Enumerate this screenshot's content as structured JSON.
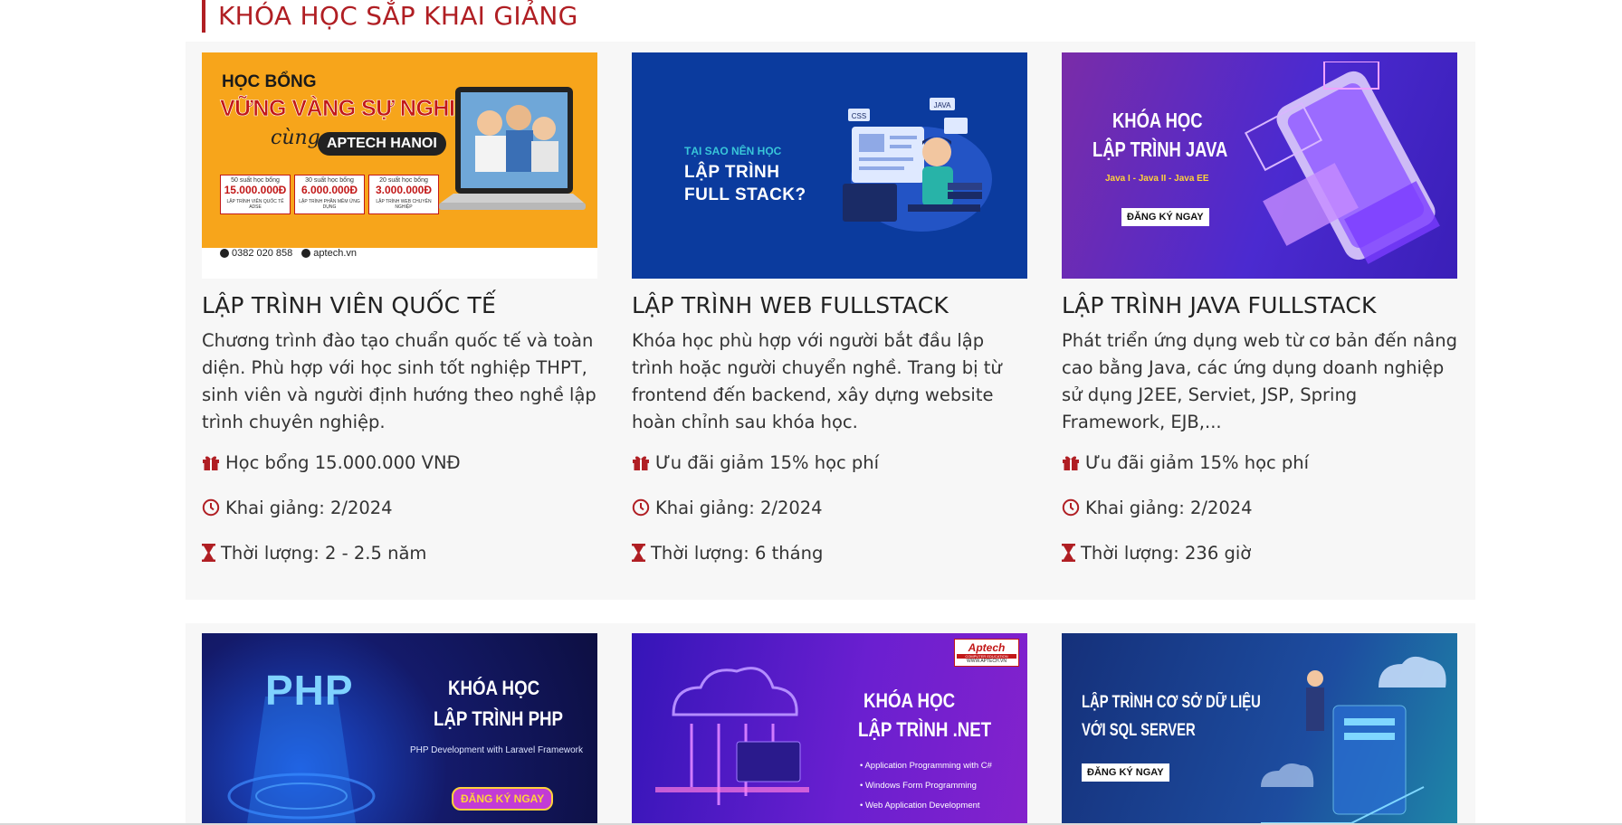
{
  "section": {
    "title": "KHÓA HỌC SẮP KHAI GIẢNG"
  },
  "colors": {
    "accent": "#b01e23",
    "panel": "#f7f7f7"
  },
  "courses": [
    {
      "title": "LẬP TRÌNH VIÊN QUỐC TẾ",
      "desc": "Chương trình đào tạo chuẩn quốc tế và toàn diện. Phù hợp với học sinh tốt nghiệp THPT, sinh viên và người định hướng theo nghề lập trình chuyên nghiệp.",
      "offer": "Học bổng 15.000.000 VNĐ",
      "start": "Khai giảng: 2/2024",
      "duration": "Thời lượng: 2 - 2.5 năm",
      "banner": {
        "l1": "HỌC BỔNG",
        "l2": "VỮNG VÀNG SỰ NGHIỆP",
        "l3": "cùng",
        "brand": "APTECH HANOI",
        "boxes": [
          {
            "cap": "50 suất học bổng",
            "amt": "15.000.000Đ",
            "sub": "LẬP TRÌNH VIÊN QUỐC TẾ ADSE"
          },
          {
            "cap": "30 suất học bổng",
            "amt": "6.000.000Đ",
            "sub": "LẬP TRÌNH PHẦN MỀM ỨNG DỤNG"
          },
          {
            "cap": "20 suất học bổng",
            "amt": "3.000.000Đ",
            "sub": "LẬP TRÌNH WEB CHUYÊN NGHIỆP"
          }
        ],
        "phone": "0382 020 858",
        "site": "aptech.vn"
      }
    },
    {
      "title": "LẬP TRÌNH WEB FULLSTACK",
      "desc": "Khóa học phù hợp với người bắt đầu lập trình hoặc người chuyển nghề. Trang bị từ frontend đến backend, xây dựng website hoàn chỉnh sau khóa học.",
      "offer": "Ưu đãi giảm 15% học phí",
      "start": "Khai giảng: 2/2024",
      "duration": "Thời lượng: 6 tháng",
      "banner": {
        "l1": "TẠI SAO NÊN HỌC",
        "l2": "LẬP TRÌNH",
        "l3": "FULL STACK?",
        "t1": "CSS",
        "t2": "JAVA"
      }
    },
    {
      "title": "LẬP TRÌNH JAVA FULLSTACK",
      "desc": "Phát triển ứng dụng web từ cơ bản đến nâng cao bằng Java, các ứng dụng doanh nghiệp sử dụng J2EE, Serviet, JSP, Spring Framework, EJB,...",
      "offer": "Ưu đãi giảm 15% học phí",
      "start": "Khai giảng: 2/2024",
      "duration": "Thời lượng: 236 giờ",
      "banner": {
        "l1": "KHÓA HỌC",
        "l2": "LẬP TRÌNH JAVA",
        "l3": "Java I - Java II - Java EE",
        "btn": "ĐĂNG KÝ NGAY"
      }
    }
  ],
  "row2": [
    {
      "logo": "PHP",
      "l1": "KHÓA HỌC",
      "l2": "LẬP TRÌNH PHP",
      "l3": "PHP Development with Laravel Framework",
      "btn": "ĐĂNG KÝ NGAY"
    },
    {
      "badge": "Aptech",
      "badge_sub": "COMPUTER EDUCATION",
      "badge_site": "WWW.APTECH.VN",
      "l1": "KHÓA HỌC",
      "l2": "LẬP TRÌNH .NET",
      "items": [
        "Application Programming with C#",
        "Windows Form Programming",
        "Web Application Development"
      ]
    },
    {
      "l1": "LẬP TRÌNH CƠ SỞ DỮ LIỆU",
      "l2": "VỚI SQL SERVER",
      "btn": "ĐĂNG KÝ NGAY"
    }
  ]
}
